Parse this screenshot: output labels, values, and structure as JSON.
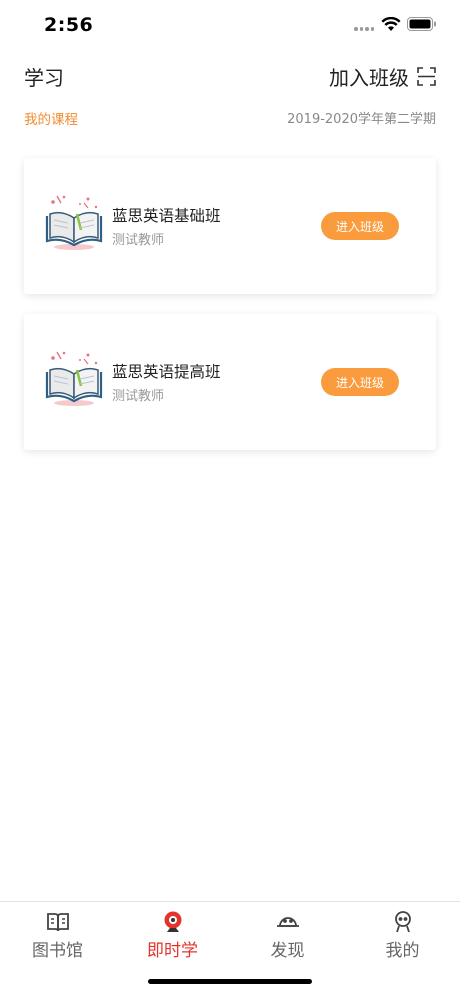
{
  "status_bar": {
    "time": "2:56"
  },
  "header": {
    "title": "学习",
    "join_label": "加入班级"
  },
  "sub_header": {
    "my_courses": "我的课程",
    "semester": "2019-2020学年第二学期"
  },
  "courses": [
    {
      "name": "蓝思英语基础班",
      "teacher": "测试教师",
      "button": "进入班级"
    },
    {
      "name": "蓝思英语提高班",
      "teacher": "测试教师",
      "button": "进入班级"
    }
  ],
  "tabs": [
    {
      "label": "图书馆",
      "icon": "book-icon"
    },
    {
      "label": "即时学",
      "icon": "webcam-icon"
    },
    {
      "label": "发现",
      "icon": "planet-icon"
    },
    {
      "label": "我的",
      "icon": "person-icon"
    }
  ],
  "colors": {
    "accent": "#f08c33",
    "button": "#fa9b3d",
    "active_tab": "#e2342b"
  }
}
